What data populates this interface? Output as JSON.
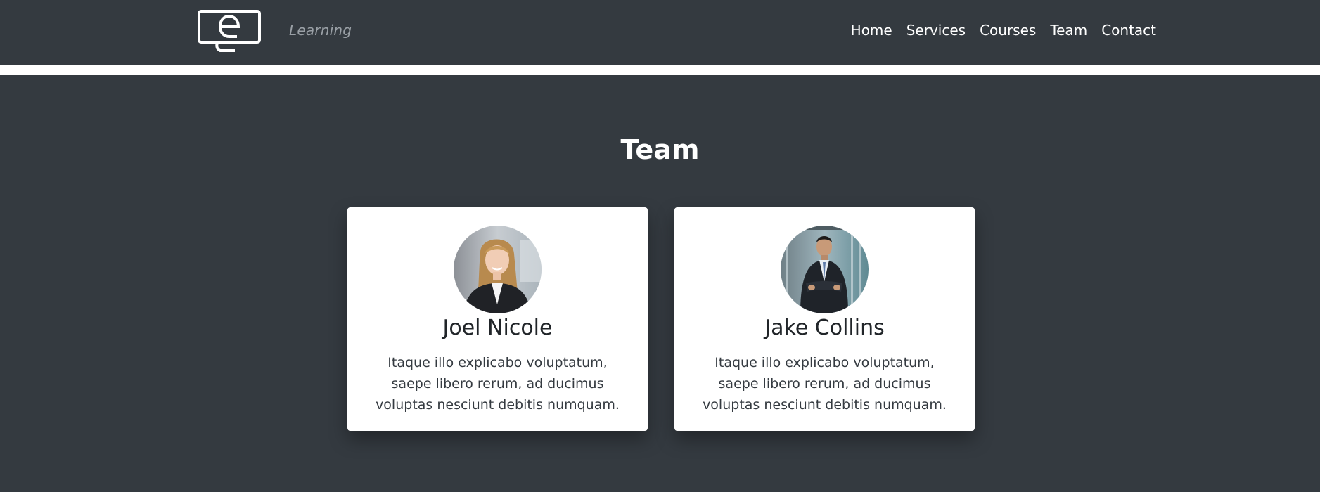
{
  "header": {
    "brand_tagline": "Learning",
    "logo_icon": "monitor-e-logo-icon",
    "nav": [
      {
        "label": "Home"
      },
      {
        "label": "Services"
      },
      {
        "label": "Courses"
      },
      {
        "label": "Team"
      },
      {
        "label": "Contact"
      }
    ]
  },
  "team": {
    "title": "Team",
    "members": [
      {
        "name": "Joel Nicole",
        "bio": "Itaque illo explicabo voluptatum, saepe libero rerum, ad ducimus voluptas nesciunt debitis numquam."
      },
      {
        "name": "Jake Collins",
        "bio": "Itaque illo explicabo voluptatum, saepe libero rerum, ad ducimus voluptas nesciunt debitis numquam."
      }
    ]
  },
  "colors": {
    "background": "#343a40",
    "card": "#ffffff",
    "text_dark": "#212529",
    "tagline": "#9aa0a6"
  }
}
